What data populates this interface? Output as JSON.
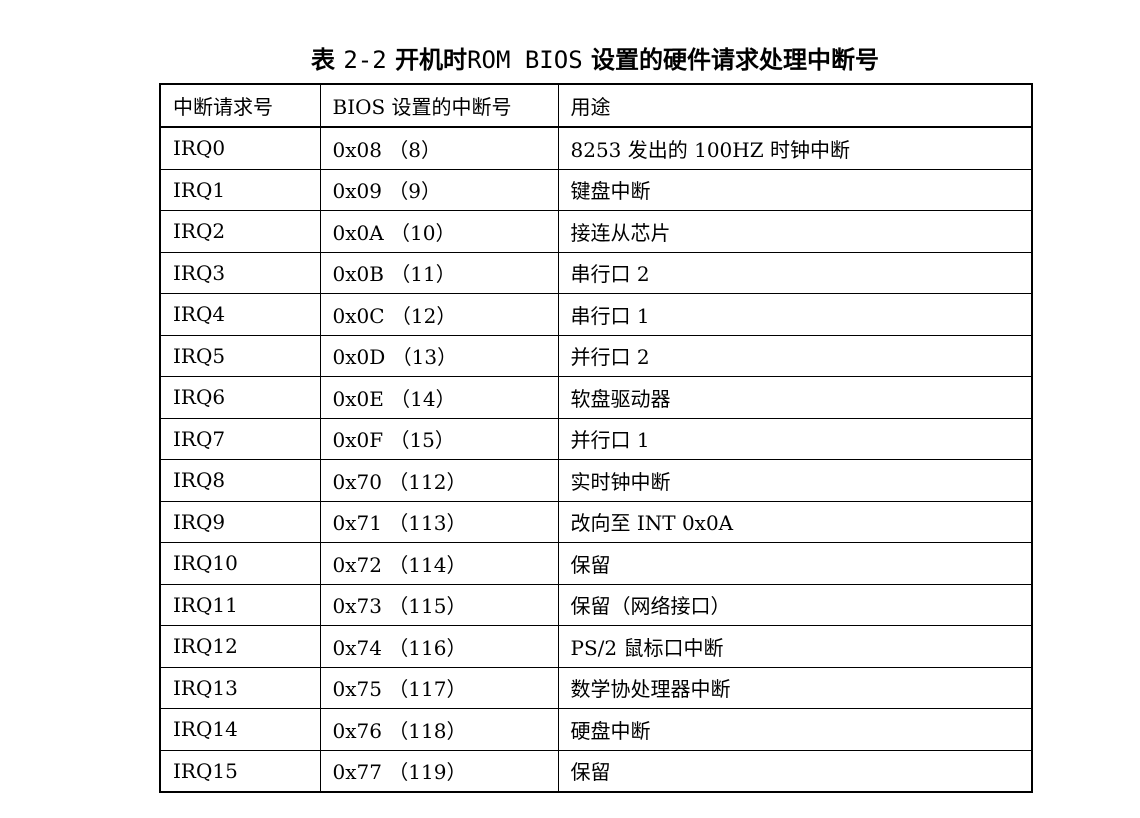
{
  "caption": {
    "prefix": "表",
    "number": "2-2",
    "part1": "开机时",
    "rom_bios": "ROM BIOS",
    "part2": "设置的硬件请求处理中断号"
  },
  "table": {
    "headers": [
      "中断请求号",
      "BIOS 设置的中断号",
      "用途"
    ],
    "rows": [
      [
        "IRQ0",
        "0x08 （8）",
        "8253 发出的 100HZ 时钟中断"
      ],
      [
        "IRQ1",
        "0x09 （9）",
        "键盘中断"
      ],
      [
        "IRQ2",
        "0x0A （10）",
        "接连从芯片"
      ],
      [
        "IRQ3",
        "0x0B （11）",
        "串行口 2"
      ],
      [
        "IRQ4",
        "0x0C （12）",
        "串行口 1"
      ],
      [
        "IRQ5",
        "0x0D （13）",
        "并行口 2"
      ],
      [
        "IRQ6",
        "0x0E （14）",
        "软盘驱动器"
      ],
      [
        "IRQ7",
        "0x0F （15）",
        "并行口 1"
      ],
      [
        "IRQ8",
        "0x70 （112）",
        "实时钟中断"
      ],
      [
        "IRQ9",
        "0x71 （113）",
        "改向至 INT 0x0A"
      ],
      [
        "IRQ10",
        "0x72 （114）",
        "保留"
      ],
      [
        "IRQ11",
        "0x73 （115）",
        "保留（网络接口）"
      ],
      [
        "IRQ12",
        "0x74 （116）",
        "PS/2 鼠标口中断"
      ],
      [
        "IRQ13",
        "0x75 （117）",
        "数学协处理器中断"
      ],
      [
        "IRQ14",
        "0x76 （118）",
        "硬盘中断"
      ],
      [
        "IRQ15",
        "0x77 （119）",
        "保留"
      ]
    ]
  }
}
